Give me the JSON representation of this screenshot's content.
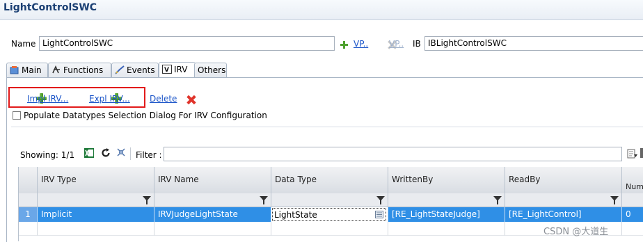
{
  "window": {
    "title": "LightControlSWC"
  },
  "form": {
    "name_label": "Name",
    "name_value": "LightControlSWC",
    "vp_link_label": "VP..",
    "vp_link_disabled_label": "VP..",
    "ib_label": "IB",
    "ib_value": "IBLightControlSWC"
  },
  "tabs": [
    {
      "label": "Main",
      "icon": "main-icon"
    },
    {
      "label": "Functions",
      "icon": "functions-icon"
    },
    {
      "label": "Events",
      "icon": "events-icon"
    },
    {
      "label": "IRV",
      "icon": "irv-icon",
      "active": true
    },
    {
      "label": "Others",
      "icon": ""
    }
  ],
  "irv_actions": {
    "impl_label": "Impl IRV...",
    "expl_label": "Expl IRV...",
    "delete_label": "Delete"
  },
  "populate_checkbox": {
    "label": "Populate Datatypes Selection Dialog For IRV Configuration",
    "checked": false
  },
  "table_toolbar": {
    "showing": "Showing: 1/1",
    "filter_label": "Filter :",
    "filter_value": ""
  },
  "table": {
    "columns": [
      "IRV Type",
      "IRV Name",
      "Data Type",
      "WrittenBy",
      "ReadBy",
      "Num"
    ],
    "rows": [
      {
        "index": "1",
        "irv_type": "Implicit",
        "irv_name": "IRVJudgeLightState",
        "data_type": "LightState",
        "written_by": "[RE_LightStateJudge]",
        "read_by": "[RE_LightControl]",
        "num": "0"
      }
    ]
  },
  "watermark": "CSDN @大道生",
  "colors": {
    "selection": "#2f8fe6",
    "highlight_box": "#e21a1a",
    "link": "#1a54c8",
    "title": "#1a3f73"
  }
}
